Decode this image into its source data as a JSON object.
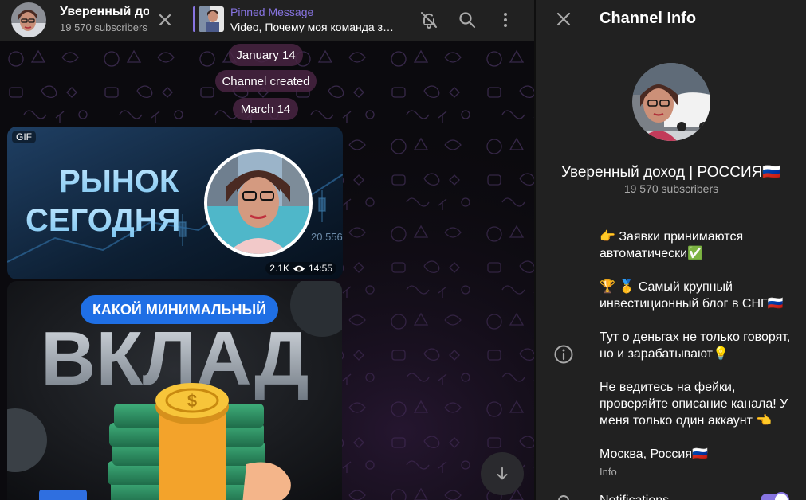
{
  "chat_header": {
    "title": "Уверенный доход | РОССИЯ",
    "subscribers": "19 570 subscribers",
    "pinned_label": "Pinned Message",
    "pinned_text": "Video, Почему моя команда заработала..."
  },
  "service_messages": [
    "January 14",
    "Channel created",
    "March 14"
  ],
  "message_1": {
    "badge": "GIF",
    "headline_line1": "РЫНОК",
    "headline_line2": "СЕГОДНЯ",
    "views": "2.1K",
    "time": "14:55",
    "chart_label": "20.556"
  },
  "message_2": {
    "banner": "КАКОЙ МИНИМАЛЬНЫЙ",
    "headline": "ВКЛАД"
  },
  "panel": {
    "title": "Channel Info",
    "name": "Уверенный доход | РОССИЯ🇷🇺",
    "subscribers": "19 570 subscribers",
    "description": [
      "👉 Заявки принимаются автоматически✅",
      "🏆 🥇 Самый крупный инвестиционный блог в СНГ🇷🇺",
      "Тут о деньгах не только говорят, но и зарабатывают💡",
      "Не ведитесь на фейки, проверяйте описание канала! У меня только один аккаунт  👈",
      "Москва, Россия🇷🇺"
    ],
    "info_label": "Info",
    "notifications_label": "Notifications",
    "notifications_enabled": true
  },
  "colors": {
    "accent": "#8774e1",
    "panel_bg": "#212121",
    "chat_bg": "#0b0a0e",
    "service_pill": "#4a2644"
  }
}
